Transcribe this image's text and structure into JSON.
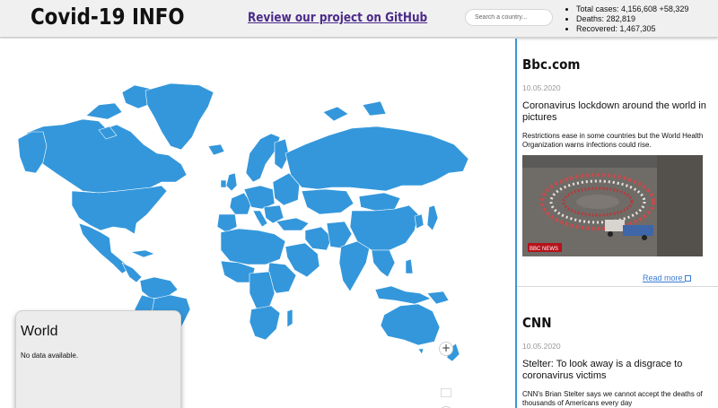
{
  "header": {
    "title": "Covid-19 INFO",
    "github_link": "Review our project on GitHub",
    "search_placeholder": "Search a country..."
  },
  "stats": {
    "total": "Total cases: 4,156,608 +58,329",
    "deaths": "Deaths: 282,819",
    "recovered": "Recovered: 1,467,305"
  },
  "map": {
    "country_color": "#3497db",
    "border_color": "#ffffff",
    "panel_title": "World",
    "panel_text": "No data available.",
    "zoom_in": "+",
    "zoom_out": "−"
  },
  "news": {
    "accent": "#3c96d8",
    "articles": [
      {
        "source": "Bbc.com",
        "date": "10.05.2020",
        "headline": "Coronavirus lockdown around the world in pictures",
        "description": "Restrictions ease in some countries but the World Health Organization warns infections could rise.",
        "image_badge": "BBC NEWS",
        "read_more": "Read more"
      },
      {
        "source": "CNN",
        "date": "10.05.2020",
        "headline": "Stelter: To look away is a disgrace to coronavirus victims",
        "description": "CNN's Brian Stelter says we cannot accept the deaths of thousands of Americans every day"
      }
    ]
  }
}
